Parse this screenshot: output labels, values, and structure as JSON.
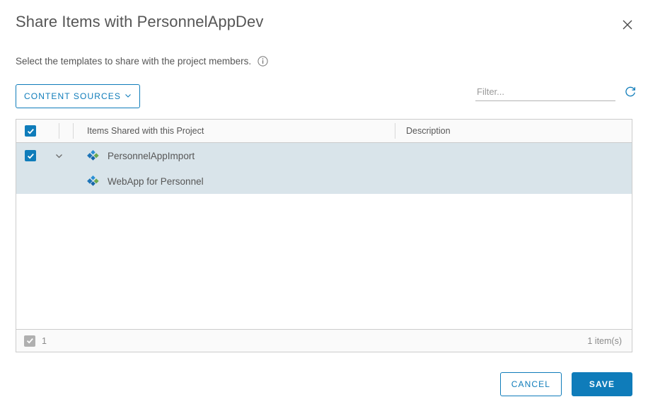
{
  "dialog": {
    "title": "Share Items with PersonnelAppDev",
    "subtitle": "Select the templates to share with the project members.",
    "close_label": "×"
  },
  "toolbar": {
    "content_sources_label": "CONTENT SOURCES",
    "filter_placeholder": "Filter...",
    "filter_value": ""
  },
  "table": {
    "columns": {
      "name": "Items Shared with this Project",
      "description": "Description"
    },
    "rows": [
      {
        "label": "PersonnelAppImport",
        "description": "",
        "checked": true,
        "expanded": true,
        "child": false
      },
      {
        "label": "WebApp for Personnel",
        "description": "",
        "checked": false,
        "expanded": false,
        "child": true
      }
    ],
    "footer": {
      "selected_count": "1",
      "item_count": "1 item(s)"
    }
  },
  "actions": {
    "cancel_label": "CANCEL",
    "save_label": "SAVE"
  },
  "colors": {
    "accent": "#0f7cba",
    "selected_row": "#d9e4ea",
    "text": "#565656",
    "border": "#cccccc"
  }
}
